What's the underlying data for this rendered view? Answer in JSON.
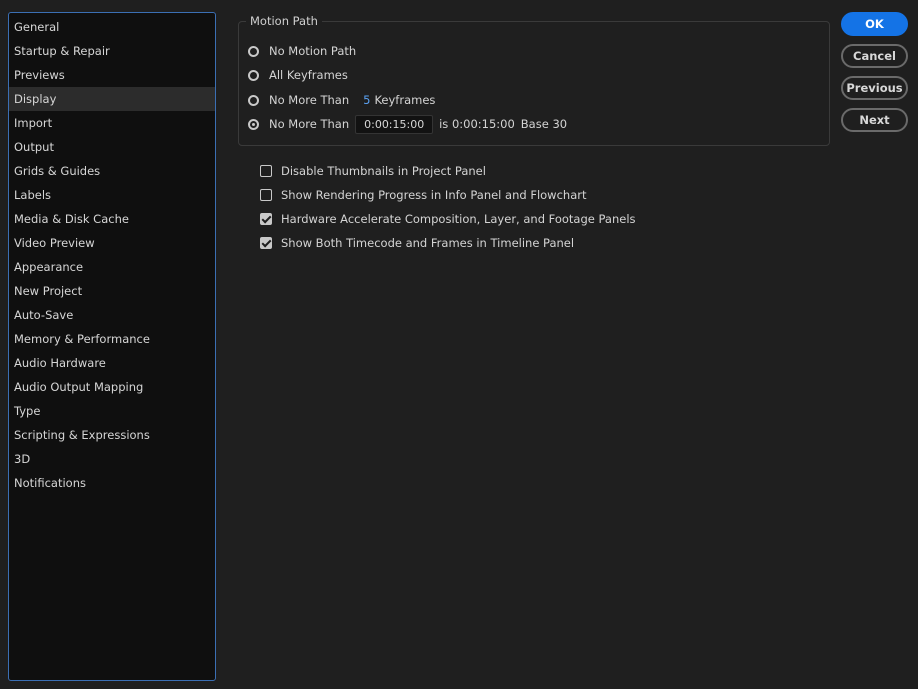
{
  "sidebar": {
    "items": [
      {
        "label": "General"
      },
      {
        "label": "Startup & Repair"
      },
      {
        "label": "Previews"
      },
      {
        "label": "Display",
        "selected": true
      },
      {
        "label": "Import"
      },
      {
        "label": "Output"
      },
      {
        "label": "Grids & Guides"
      },
      {
        "label": "Labels"
      },
      {
        "label": "Media & Disk Cache"
      },
      {
        "label": "Video Preview"
      },
      {
        "label": "Appearance"
      },
      {
        "label": "New Project"
      },
      {
        "label": "Auto-Save"
      },
      {
        "label": "Memory & Performance"
      },
      {
        "label": "Audio Hardware"
      },
      {
        "label": "Audio Output Mapping"
      },
      {
        "label": "Type"
      },
      {
        "label": "Scripting & Expressions"
      },
      {
        "label": "3D"
      },
      {
        "label": "Notifications"
      }
    ]
  },
  "motion_path": {
    "title": "Motion Path",
    "options": {
      "no_motion_path": {
        "label": "No Motion Path",
        "selected": false
      },
      "all_keyframes": {
        "label": "All Keyframes",
        "selected": false
      },
      "no_more_than_keyframes": {
        "label": "No More Than",
        "value": "5",
        "unit": "Keyframes",
        "selected": false
      },
      "no_more_than_time": {
        "label": "No More Than",
        "value": "0:00:15:00",
        "is_text": "is 0:00:15:00",
        "base_text": "Base 30",
        "selected": true
      }
    }
  },
  "checkboxes": {
    "disable_thumbnails": {
      "label": "Disable Thumbnails in Project Panel",
      "checked": false
    },
    "show_rendering_progress": {
      "label": "Show Rendering Progress in Info Panel and Flowchart",
      "checked": false
    },
    "hardware_accelerate": {
      "label": "Hardware Accelerate Composition, Layer, and Footage Panels",
      "checked": true
    },
    "show_timecode_frames": {
      "label": "Show Both Timecode and Frames in Timeline Panel",
      "checked": true
    }
  },
  "buttons": {
    "ok": "OK",
    "cancel": "Cancel",
    "previous": "Previous",
    "next": "Next"
  },
  "colors": {
    "accent": "#1473e6",
    "keyframe_number": "#5aa0f0",
    "sidebar_border": "#3b6fb4"
  }
}
